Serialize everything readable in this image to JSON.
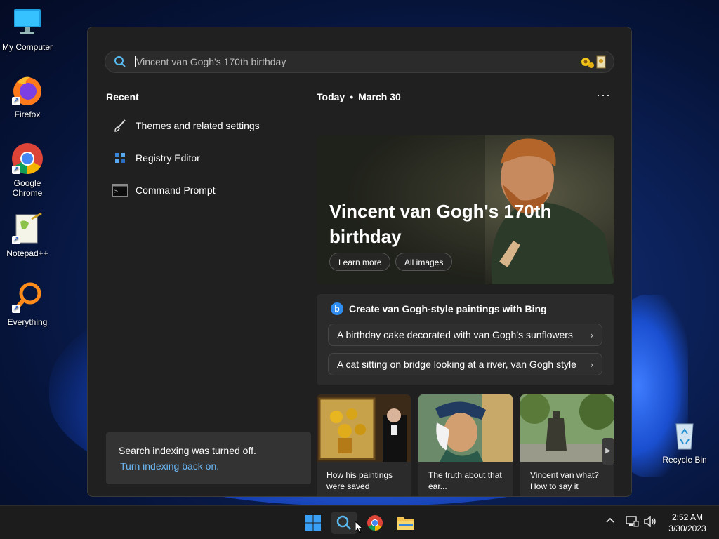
{
  "desktop": {
    "icons": [
      {
        "label": "My Computer"
      },
      {
        "label": "Firefox"
      },
      {
        "label": "Google Chrome"
      },
      {
        "label": "Notepad++"
      },
      {
        "label": "Everything"
      },
      {
        "label": "Recycle Bin"
      }
    ]
  },
  "search": {
    "placeholder": "Vincent van Gogh's 170th birthday"
  },
  "recent": {
    "title": "Recent",
    "items": [
      {
        "label": "Themes and related settings",
        "icon": "paintbrush-icon"
      },
      {
        "label": "Registry Editor",
        "icon": "registry-icon"
      },
      {
        "label": "Command Prompt",
        "icon": "terminal-icon"
      }
    ]
  },
  "indexing": {
    "message": "Search indexing was turned off.",
    "link": "Turn indexing back on."
  },
  "today": {
    "label": "Today",
    "separator": "•",
    "date": "March 30",
    "more": "···"
  },
  "hero": {
    "title": "Vincent van Gogh's 170th birthday",
    "buttons": [
      "Learn more",
      "All images"
    ]
  },
  "bing": {
    "heading": "Create van Gogh-style paintings with Bing",
    "suggestions": [
      "A birthday cake decorated with van Gogh’s sunflowers",
      "A cat sitting on bridge looking at a river, van Gogh style"
    ]
  },
  "news": [
    {
      "caption": "How his paintings were saved"
    },
    {
      "caption": "The truth about that ear..."
    },
    {
      "caption": "Vincent van what? How to say it"
    }
  ],
  "taskbar": {
    "time": "2:52 AM",
    "date": "3/30/2023"
  },
  "colors": {
    "accent": "#6cb8f5",
    "panel": "#202020",
    "card": "#2b2b2b"
  }
}
